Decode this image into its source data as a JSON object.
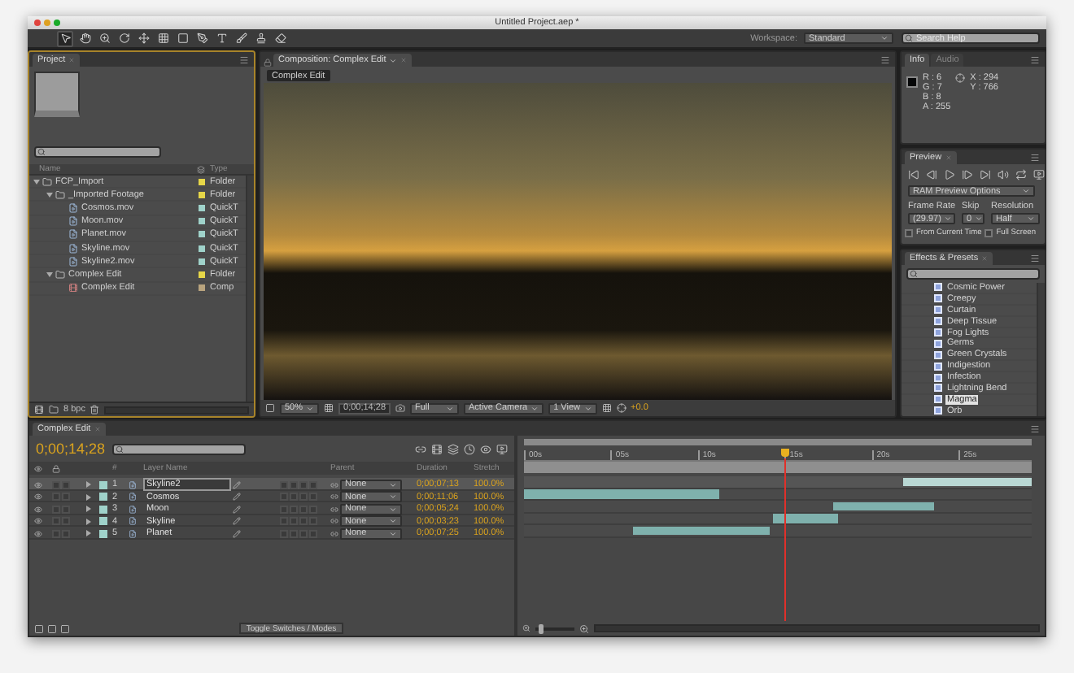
{
  "window": {
    "title": "Untitled Project.aep *"
  },
  "toolbar": {
    "tools": [
      {
        "selected": true
      },
      {
        "selected": false
      },
      {
        "selected": false
      },
      {
        "selected": false
      },
      {
        "selected": false
      },
      {
        "selected": false
      },
      {
        "selected": false
      },
      {
        "selected": false
      },
      {
        "selected": false
      },
      {
        "selected": false
      },
      {
        "selected": false
      },
      {
        "selected": false
      }
    ],
    "workspace_label": "Workspace:",
    "workspace": "Standard",
    "search_placeholder": "Search Help"
  },
  "project": {
    "tab": "Project",
    "columns": [
      "Name",
      "Type"
    ],
    "items": [
      {
        "name": "FCP_Import",
        "type": "Folder",
        "kind": "folder",
        "color": "#e6d648",
        "expanded": true,
        "children": [
          {
            "name": "_Imported Footage",
            "type": "Folder",
            "kind": "folder",
            "color": "#e6d648",
            "expanded": true,
            "children": [
              {
                "name": "Cosmos.mov",
                "type": "QuickT",
                "kind": "footage",
                "color": "#9fd2ca"
              },
              {
                "name": "Moon.mov",
                "type": "QuickT",
                "kind": "footage",
                "color": "#9fd2ca"
              },
              {
                "name": "Planet.mov",
                "type": "QuickT",
                "kind": "footage",
                "color": "#9fd2ca"
              },
              {
                "name": "Skyline.mov",
                "type": "QuickT",
                "kind": "footage",
                "color": "#9fd2ca"
              },
              {
                "name": "Skyline2.mov",
                "type": "QuickT",
                "kind": "footage",
                "color": "#9fd2ca"
              }
            ]
          },
          {
            "name": "Complex Edit",
            "type": "Folder",
            "kind": "folder",
            "color": "#e6d648",
            "expanded": true,
            "children": [
              {
                "name": "Complex Edit",
                "type": "Comp",
                "kind": "comp",
                "color": "#b9a47e"
              }
            ]
          }
        ]
      }
    ],
    "bit_depth": "8 bpc"
  },
  "composition": {
    "tab": "Composition: Complex Edit",
    "breadcrumb": "Complex Edit",
    "magnification": "50%",
    "time": "0;00;14;28",
    "resolution": "Full",
    "camera": "Active Camera",
    "views": "1 View",
    "exposure": "+0.0"
  },
  "info": {
    "tabs": [
      {
        "label": "Info",
        "selected": true
      },
      {
        "label": "Audio",
        "selected": false
      }
    ],
    "color_values": [
      "R : 6",
      "G : 7",
      "B : 8",
      "A : 255"
    ],
    "position": [
      "X : 294",
      "Y : 766"
    ]
  },
  "preview": {
    "tab": "Preview",
    "ram_preview": "RAM Preview Options",
    "labels": [
      "Frame Rate",
      "Skip",
      "Resolution"
    ],
    "frame_rate": "(29.97)",
    "skip": "0",
    "resolution": "Half",
    "options": [
      {
        "label": "From Current Time",
        "checked": false
      },
      {
        "label": "Full Screen",
        "checked": false
      }
    ]
  },
  "effects": {
    "tab": "Effects & Presets",
    "items": [
      {
        "label": "Cosmic Power",
        "selected": false
      },
      {
        "label": "Creepy",
        "selected": false
      },
      {
        "label": "Curtain",
        "selected": false
      },
      {
        "label": "Deep Tissue",
        "selected": false
      },
      {
        "label": "Fog Lights",
        "selected": false
      },
      {
        "label": "Germs",
        "selected": false
      },
      {
        "label": "Green Crystals",
        "selected": false
      },
      {
        "label": "Indigestion",
        "selected": false
      },
      {
        "label": "Infection",
        "selected": false
      },
      {
        "label": "Lightning Bend",
        "selected": false
      },
      {
        "label": "Magma",
        "selected": true
      },
      {
        "label": "Orb",
        "selected": false
      }
    ]
  },
  "timeline": {
    "tab": "Complex Edit",
    "time": "0;00;14;28",
    "columns": {
      "number": "#",
      "name": "Layer Name",
      "parent": "Parent",
      "duration": "Duration",
      "stretch": "Stretch"
    },
    "layers": [
      {
        "number": "1",
        "name": "Skyline2",
        "parent": "None",
        "duration": "0;00;07;13",
        "stretch": "100.0%",
        "selected": true
      },
      {
        "number": "2",
        "name": "Cosmos",
        "parent": "None",
        "duration": "0;00;11;06",
        "stretch": "100.0%",
        "selected": false
      },
      {
        "number": "3",
        "name": "Moon",
        "parent": "None",
        "duration": "0;00;05;24",
        "stretch": "100.0%",
        "selected": false
      },
      {
        "number": "4",
        "name": "Skyline",
        "parent": "None",
        "duration": "0;00;03;23",
        "stretch": "100.0%",
        "selected": false
      },
      {
        "number": "5",
        "name": "Planet",
        "parent": "None",
        "duration": "0;00;07;25",
        "stretch": "100.0%",
        "selected": false
      }
    ],
    "ruler": {
      "labels": [
        "00s",
        "05s",
        "10s",
        "15s",
        "20s",
        "25s"
      ],
      "playhead": {
        "level": 0.514
      }
    },
    "toggle": "Toggle Switches / Modes",
    "zoom": {
      "level": 0.1
    }
  }
}
